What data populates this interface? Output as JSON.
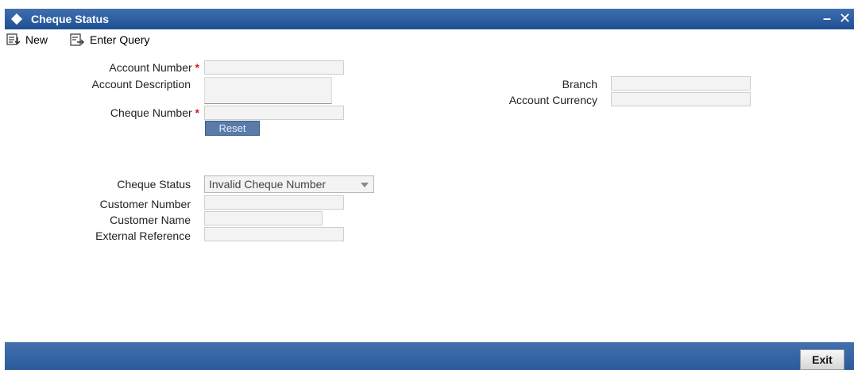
{
  "window": {
    "title": "Cheque Status",
    "minimize": "–",
    "close": "✕"
  },
  "toolbar": {
    "new_label": "New",
    "enter_query_label": "Enter Query"
  },
  "form": {
    "account_number_label": "Account Number",
    "account_description_label": "Account Description",
    "cheque_number_label": "Cheque Number",
    "required_marker": "*",
    "branch_label": "Branch",
    "account_currency_label": "Account Currency",
    "reset_label": "Reset",
    "cheque_status_label": "Cheque Status",
    "cheque_status_value": "Invalid Cheque Number",
    "customer_number_label": "Customer Number",
    "customer_name_label": "Customer Name",
    "external_reference_label": "External Reference"
  },
  "footer": {
    "exit_label": "Exit"
  },
  "colors": {
    "titlebar": "#2b5ea3",
    "required": "#d12020",
    "footer": "#3565a5"
  },
  "icons": {
    "title": "diamond-icon",
    "new": "new-record-icon",
    "enter_query": "enter-query-icon",
    "select": "chevron-down-icon"
  }
}
